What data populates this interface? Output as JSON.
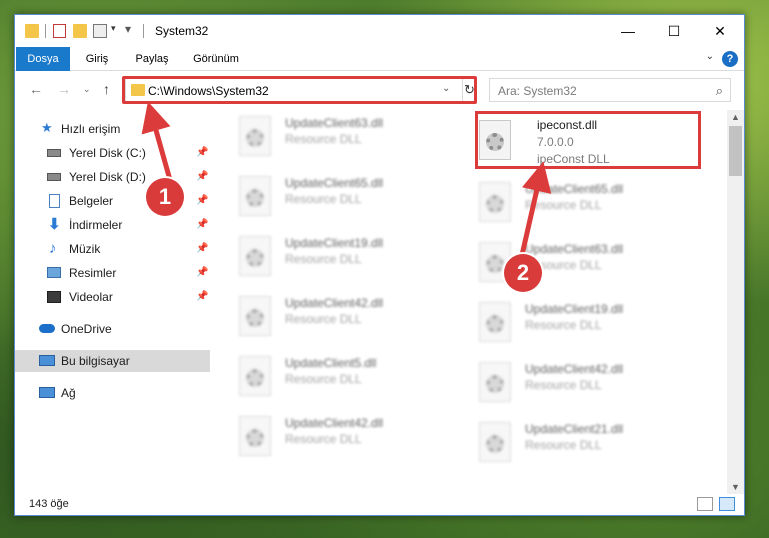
{
  "window": {
    "title": "System32"
  },
  "ribbon": {
    "tabs": [
      "Dosya",
      "Giriş",
      "Paylaş",
      "Görünüm"
    ]
  },
  "address": {
    "path": "C:\\Windows\\System32"
  },
  "search": {
    "placeholder": "Ara: System32"
  },
  "sidebar": {
    "quick_access": "Hızlı erişim",
    "items": [
      {
        "label": "Yerel Disk (C:)",
        "icon": "drive-icon"
      },
      {
        "label": "Yerel Disk (D:)",
        "icon": "drive-icon"
      },
      {
        "label": "Belgeler",
        "icon": "documents-icon"
      },
      {
        "label": "İndirmeler",
        "icon": "download-icon"
      },
      {
        "label": "Müzik",
        "icon": "music-icon"
      },
      {
        "label": "Resimler",
        "icon": "pictures-icon"
      },
      {
        "label": "Videolar",
        "icon": "videos-icon"
      }
    ],
    "onedrive": "OneDrive",
    "this_pc": "Bu bilgisayar",
    "network": "Ağ"
  },
  "files": {
    "left": [
      {
        "name": "UpdateClient63.dll",
        "type": "Resource DLL"
      },
      {
        "name": "UpdateClient65.dll",
        "type": "Resource DLL"
      },
      {
        "name": "UpdateClient19.dll",
        "type": "Resource DLL"
      },
      {
        "name": "UpdateClient42.dll",
        "type": "Resource DLL"
      },
      {
        "name": "UpdateClient5.dll",
        "type": "Resource DLL"
      },
      {
        "name": "UpdateClient42.dll",
        "type": "Resource DLL"
      }
    ],
    "right": [
      {
        "name": "UpdateClient65.dll",
        "type": "Resource DLL"
      },
      {
        "name": "UpdateClient63.dll",
        "type": "Resource DLL"
      },
      {
        "name": "UpdateClient19.dll",
        "type": "Resource DLL"
      },
      {
        "name": "UpdateClient42.dll",
        "type": "Resource DLL"
      },
      {
        "name": "UpdateClient21.dll",
        "type": "Resource DLL"
      }
    ],
    "highlighted": {
      "name": "ipeconst.dll",
      "version": "7.0.0.0",
      "description": "ipeConst DLL"
    }
  },
  "status": {
    "count": "143 öğe"
  },
  "annotations": {
    "step1": "1",
    "step2": "2",
    "color": "#dc3b3b"
  }
}
